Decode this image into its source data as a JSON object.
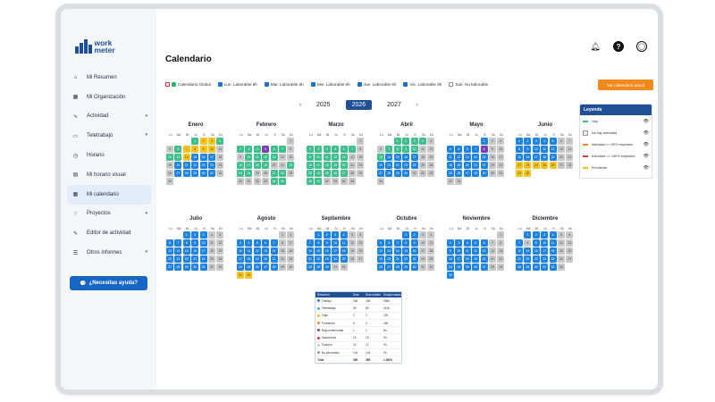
{
  "app": {
    "logo_line1": "work",
    "logo_line2": "meter",
    "window_dots": [
      "#ff5f57",
      "#febc2e",
      "#28c840"
    ]
  },
  "sidebar": {
    "items": [
      {
        "label": "Mi Resumen",
        "icon": "home-icon",
        "glyph": "⌂"
      },
      {
        "label": "Mi Organización",
        "icon": "organization-icon",
        "glyph": "▦"
      },
      {
        "label": "Actividad",
        "icon": "activity-icon",
        "glyph": "∿",
        "chevron": true
      },
      {
        "label": "Teletrabajo",
        "icon": "remote-work-icon",
        "glyph": "▭",
        "chevron": true
      },
      {
        "label": "Horario",
        "icon": "clock-icon",
        "glyph": "◷"
      },
      {
        "label": "Mi horario visual",
        "icon": "visual-schedule-icon",
        "glyph": "▤"
      },
      {
        "label": "Mi calendario",
        "icon": "calendar-icon",
        "glyph": "▦",
        "active": true
      },
      {
        "label": "Proyectos",
        "icon": "projects-icon",
        "glyph": "⁙",
        "chevron": true
      },
      {
        "label": "Editor de actividad",
        "icon": "edit-icon",
        "glyph": "✎"
      },
      {
        "label": "Otros informes",
        "icon": "reports-icon",
        "glyph": "☰",
        "chevron": true
      }
    ],
    "help_label": "¿Necesitas ayuda?"
  },
  "header": {
    "title": "Calendario",
    "icons": [
      "bell-icon",
      "help-icon",
      "user-icon"
    ]
  },
  "filters": [
    {
      "label": "Calendario Global",
      "state": "red-green"
    },
    {
      "label": "Lun. Laborable 6h",
      "state": "on"
    },
    {
      "label": "Mar. Laborable 6h",
      "state": "on"
    },
    {
      "label": "Mie. Laborable 6h",
      "state": "on"
    },
    {
      "label": "Jue. Laborable 6h",
      "state": "on"
    },
    {
      "label": "Vie. Laborable 6h",
      "state": "on"
    },
    {
      "label": "Sab. No laborable",
      "state": "off"
    }
  ],
  "view_button": "Ver calendario anual",
  "years": {
    "items": [
      "2025",
      "2026",
      "2027"
    ],
    "active": "2026",
    "prev": "‹",
    "next": "›"
  },
  "dow_labels": [
    "Lu",
    "Ma",
    "Mi",
    "Ju",
    "Vi",
    "Sá",
    "Do"
  ],
  "colors": {
    "b": "#1f84e0",
    "g": "#3fbf8c",
    "y": "#f5c31b",
    "r": "#cc3a4a",
    "p": "#7a3fb0",
    "x": "#c8c8c8",
    "o": "#ee8a2a"
  },
  "months": [
    {
      "name": "Enero",
      "offset": 3,
      "codes": "gyygxgyyyyxggybbbxxbbbbbxxbbbbbxx"
    },
    {
      "name": "Febrero",
      "offset": 6,
      "codes": "xgggpggxxggggxxggggxxgggxxggxxxxxgg"
    },
    {
      "name": "Marzo",
      "offset": 6,
      "codes": "xggggggxgggggxxgggggxxgggggxxggxxxx"
    },
    {
      "name": "Abril",
      "offset": 2,
      "codes": "ggggxxggggxxgbbbbxxbbbbbxxbbbbxxxx"
    },
    {
      "name": "Mayo",
      "offset": 4,
      "codes": "bxxbbbbpxxbbbbbxxbbbbbxxbbbbbxxxx"
    },
    {
      "name": "Junio",
      "offset": 0,
      "codes": "bbbbbxxbbbbbxxbbbbbxxyyyyyxxyy"
    },
    {
      "name": "Julio",
      "offset": 2,
      "codes": "bbbxxbbbbbxxbbbbbxxbbbbbxxbbbbbxx"
    },
    {
      "name": "Agosto",
      "offset": 5,
      "codes": "xxbbbbbxxbbbbbxxbbbbbxxbbbbbxxyy"
    },
    {
      "name": "Septiembre",
      "offset": 1,
      "codes": "bbbbxxbbbbbxxbbbbbxxbbbbbxxbbbxx"
    },
    {
      "name": "Octubre",
      "offset": 3,
      "codes": "bbxxbbbbbxxbbbbbxxbbbbbxxbbbbbxx"
    },
    {
      "name": "Noviembre",
      "offset": 6,
      "codes": "xbbbbbxxbbbbbxxbbbbbxxbbbbbxxb"
    },
    {
      "name": "Diciembre",
      "offset": 1,
      "codes": "bbbbxxbxbbbxxbbbbbxxbbbbbxxbbbbbx"
    }
  ],
  "legend": {
    "title": "Leyenda",
    "items": [
      {
        "label": "Hoy",
        "color": "#3fbf8c",
        "kind": "line"
      },
      {
        "label": "No hay actividad",
        "color": "#e8e8e8",
        "kind": "box"
      },
      {
        "label": "Actividad <= 50% esperado",
        "color": "#ee8a2a",
        "kind": "line"
      },
      {
        "label": "Actividad <= 130% esperado",
        "color": "#cc3a4a",
        "kind": "line"
      },
      {
        "label": "Pendiente",
        "color": "#f5c31b",
        "kind": "line"
      }
    ]
  },
  "summary": {
    "headers": [
      "Resumen",
      "Días",
      "Días totales",
      "Días/jornadas"
    ],
    "rows": [
      {
        "label": "Trabajo",
        "color": "#1f84e0",
        "c1": "156",
        "c2": "156",
        "c3": "936h"
      },
      {
        "label": "Teletrabajo",
        "color": "#3fbf8c",
        "c1": "69",
        "c2": "69",
        "c3": "414h"
      },
      {
        "label": "Viaje",
        "color": "#f5c31b",
        "c2": "2",
        "c1": "2",
        "c3": "12h"
      },
      {
        "label": "Formación",
        "color": "#ee8a2a",
        "c1": "3",
        "c2": "3",
        "c3": "18h"
      },
      {
        "label": "Baja enfermedad",
        "color": "#7a3fb0",
        "c1": "1",
        "c2": "1",
        "c3": "6h"
      },
      {
        "label": "Vacaciones",
        "color": "#cc3a4a",
        "c1": "15",
        "c2": "15",
        "c3": "0h"
      },
      {
        "label": "Festivos",
        "color": "#c8c8c8",
        "c1": "12",
        "c2": "12",
        "c3": "0h"
      },
      {
        "label": "No laborables",
        "color": "#999999",
        "c1": "104",
        "c2": "104",
        "c3": "0h"
      }
    ],
    "total": {
      "label": "Total",
      "c1": "365",
      "c2": "365",
      "c3": "1.380h"
    }
  }
}
